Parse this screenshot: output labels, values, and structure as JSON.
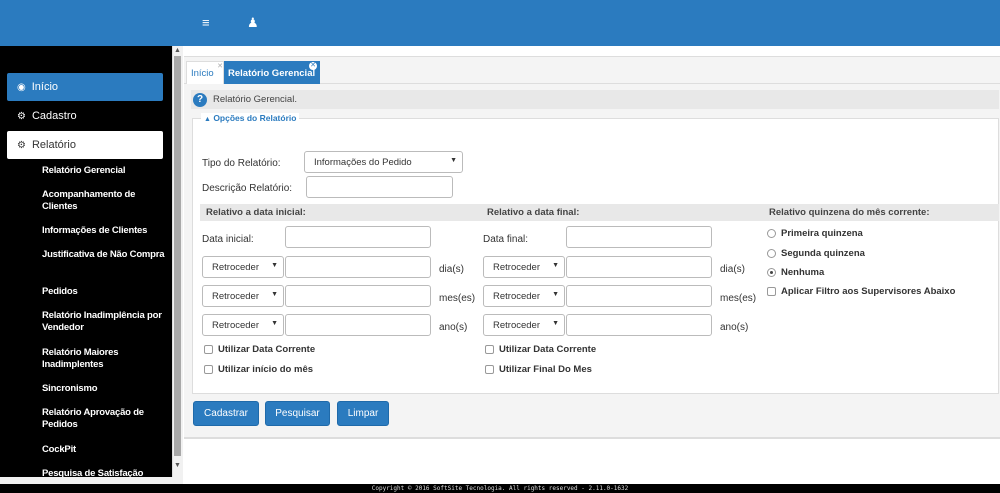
{
  "topbar": {
    "menu_icon": "menu-icon",
    "user_icon": "user-icon",
    "menu_glyph": "≡",
    "user_glyph": "♟"
  },
  "sidebar": {
    "items": [
      {
        "label": "Início",
        "icon": "dashboard-icon"
      },
      {
        "label": "Cadastro",
        "icon": "cogs-icon"
      },
      {
        "label": "Relatório",
        "icon": "cogs-icon"
      }
    ],
    "submenu": [
      "Relatório Gerencial",
      "Acompanhamento de Clientes",
      "Informações de Clientes",
      "Justificativa de Não Compra",
      "Pedidos",
      "Relatório Inadimplência por Vendedor",
      "Relatório Maiores Inadimplentes",
      "Sincronismo",
      "Relatório Aprovação de Pedidos",
      "CockPit",
      "Pesquisa de Satisfação"
    ]
  },
  "tabs": [
    {
      "label": "Início"
    },
    {
      "label": "Relatório Gerencial"
    }
  ],
  "help": {
    "text": "Relatório Gerencial."
  },
  "form": {
    "legend": "Opções do Relatório",
    "legend_toggle": "▲",
    "tipo_label": "Tipo do Relatório:",
    "tipo_value": "Informações do Pedido",
    "descricao_label": "Descrição Relatório:",
    "descricao_value": "",
    "inicial": {
      "heading": "Relativo a data inicial:",
      "data_label": "Data inicial:",
      "data_value": "",
      "rows": [
        {
          "select": "Retroceder",
          "value": "",
          "unit": "dia(s)"
        },
        {
          "select": "Retroceder",
          "value": "",
          "unit": "mes(es)"
        },
        {
          "select": "Retroceder",
          "value": "",
          "unit": "ano(s)"
        }
      ],
      "check1": "Utilizar Data Corrente",
      "check2": "Utilizar início do mês"
    },
    "final": {
      "heading": "Relativo a data final:",
      "data_label": "Data final:",
      "data_value": "",
      "rows": [
        {
          "select": "Retroceder",
          "value": "",
          "unit": "dia(s)"
        },
        {
          "select": "Retroceder",
          "value": "",
          "unit": "mes(es)"
        },
        {
          "select": "Retroceder",
          "value": "",
          "unit": "ano(s)"
        }
      ],
      "check1": "Utilizar Data Corrente",
      "check2": "Utilizar Final Do Mes"
    },
    "quinzena": {
      "heading": "Relativo quinzena do mês corrente:",
      "options": [
        "Primeira quinzena",
        "Segunda quinzena",
        "Nenhuma"
      ],
      "selected": "Nenhuma",
      "filter_check": "Aplicar Filtro aos Supervisores Abaixo"
    }
  },
  "buttons": {
    "cadastrar": "Cadastrar",
    "pesquisar": "Pesquisar",
    "limpar": "Limpar"
  },
  "footer": {
    "text": "Copyright © 2016 SoftSite Tecnologia. All rights reserved - 2.11.0-1632"
  },
  "colors": {
    "primary": "#2b7bbf",
    "sidebar_bg": "#000000",
    "panel_bg": "#f4f4f4"
  }
}
